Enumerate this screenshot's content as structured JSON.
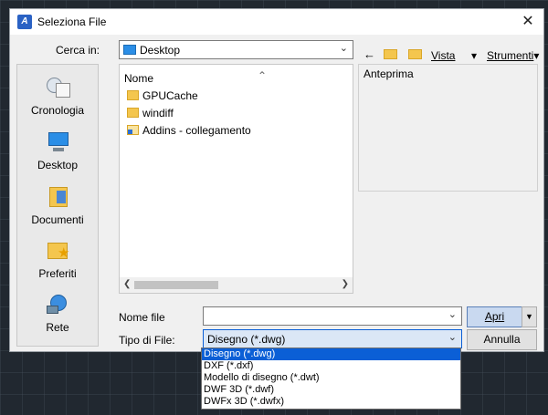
{
  "dialog": {
    "title": "Seleziona File",
    "close_symbol": "✕"
  },
  "lookin": {
    "label": "Cerca in:",
    "value": "Desktop"
  },
  "toolbar": {
    "back_symbol": "←",
    "view_label": "Vista",
    "tools_label": "Strumenti",
    "dropdown_symbol": "▾"
  },
  "places": [
    {
      "label": "Cronologia",
      "icon": "history-icon"
    },
    {
      "label": "Desktop",
      "icon": "desktop-icon"
    },
    {
      "label": "Documenti",
      "icon": "documents-icon"
    },
    {
      "label": "Preferiti",
      "icon": "favorites-icon"
    },
    {
      "label": "Rete",
      "icon": "network-icon"
    }
  ],
  "filelist": {
    "column_header": "Nome",
    "files": [
      {
        "name": "GPUCache",
        "type": "folder"
      },
      {
        "name": "windiff",
        "type": "folder"
      },
      {
        "name": "Addins - collegamento",
        "type": "shortcut"
      }
    ]
  },
  "preview": {
    "label": "Anteprima"
  },
  "filename": {
    "label": "Nome file",
    "value": ""
  },
  "filetype": {
    "label": "Tipo di File:",
    "value": "Disegno (*.dwg)"
  },
  "buttons": {
    "open": "Apri",
    "cancel": "Annulla"
  },
  "filetype_options": [
    "Disegno (*.dwg)",
    "DXF (*.dxf)",
    "Modello di disegno (*.dwt)",
    "DWF 3D (*.dwf)",
    "DWFx 3D (*.dwfx)"
  ],
  "filetype_selected_index": 0,
  "colors": {
    "selection": "#0b5fd6",
    "folder": "#f4c64e",
    "desktop_icon": "#2b8ee6",
    "primary_button": "#c9d9f0"
  }
}
